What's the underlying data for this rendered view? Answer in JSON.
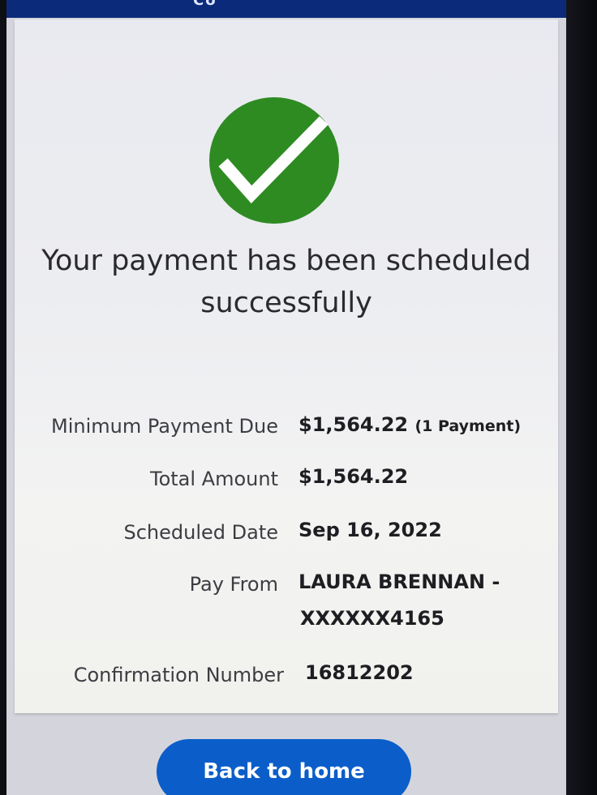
{
  "header": {
    "title_partial": "Co"
  },
  "status": {
    "icon": "checkmark-icon",
    "color": "#2e8b22",
    "message_line1": "Your payment has been scheduled",
    "message_line2": "successfully"
  },
  "details": {
    "minimum_payment_label": "Minimum Payment Due",
    "minimum_payment_value": "$1,564.22",
    "minimum_payment_note": "(1 Payment)",
    "total_label": "Total Amount",
    "total_value": "$1,564.22",
    "date_label": "Scheduled Date",
    "date_value": "Sep 16, 2022",
    "pay_from_label": "Pay From",
    "pay_from_line1": "LAURA BRENNAN -",
    "pay_from_line2": "XXXXXX4165",
    "confirmation_label": "Confirmation Number",
    "confirmation_value": "16812202"
  },
  "actions": {
    "back_home_label": "Back to home",
    "accent_color": "#0b5ec9"
  }
}
